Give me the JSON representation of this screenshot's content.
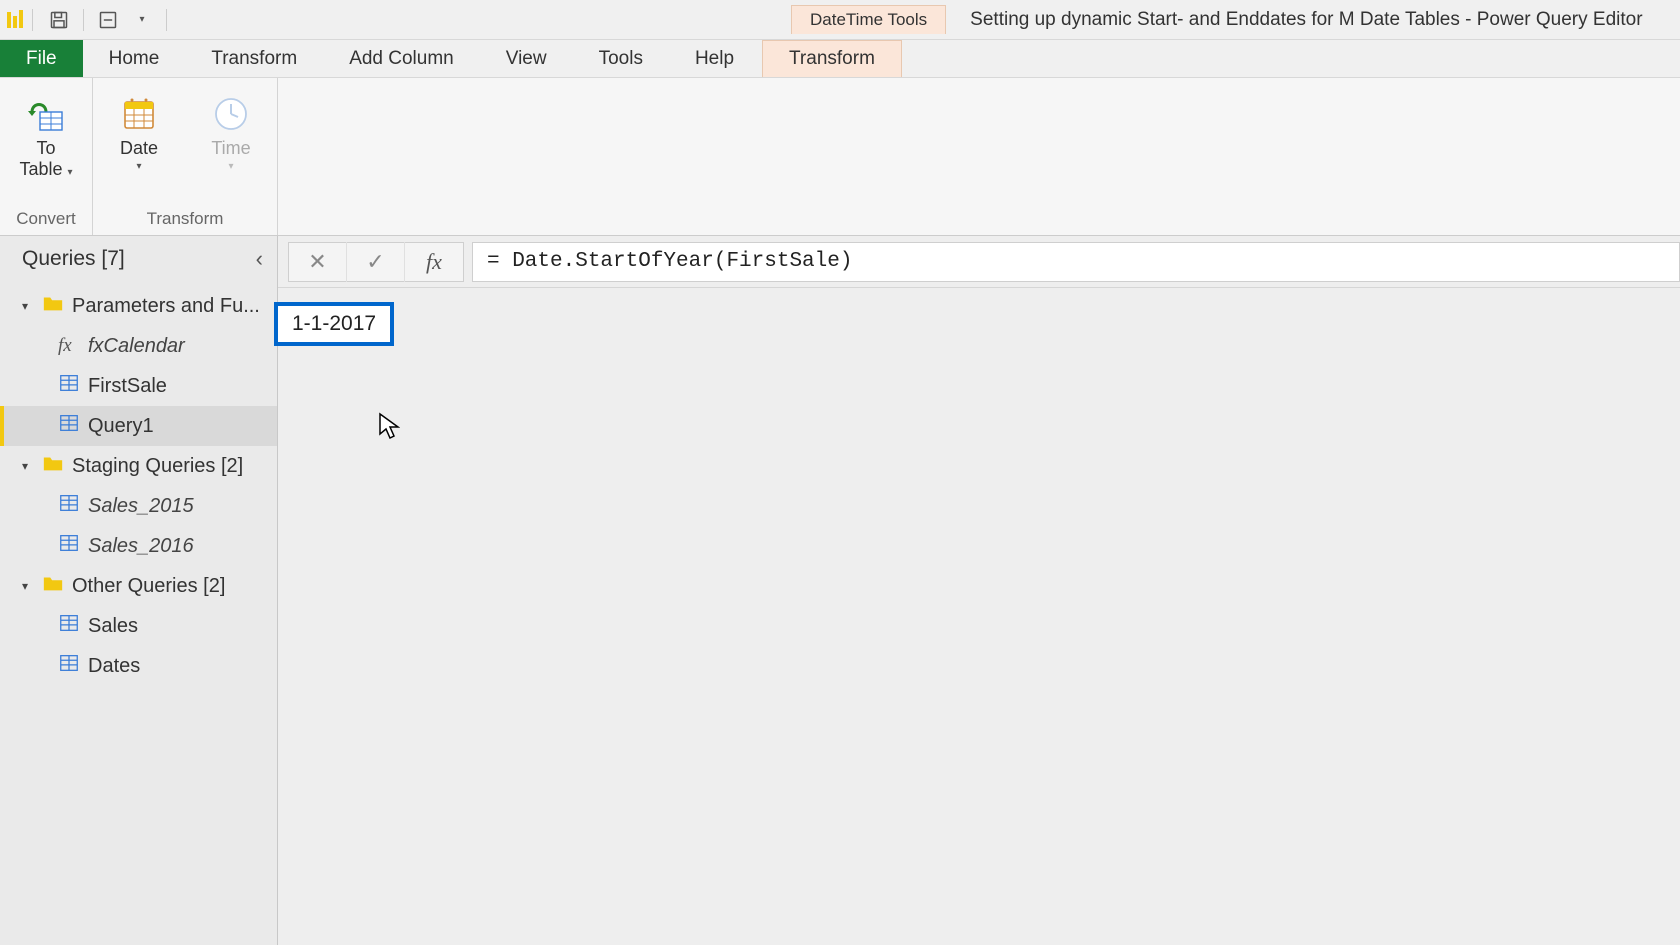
{
  "titlebar": {
    "contextual_tab": "DateTime Tools",
    "window_title": "Setting up dynamic Start- and Enddates for M Date Tables - Power Query Editor"
  },
  "ribbon_tabs": {
    "file": "File",
    "home": "Home",
    "transform": "Transform",
    "add_column": "Add Column",
    "view": "View",
    "tools": "Tools",
    "help": "Help",
    "contextual_transform": "Transform"
  },
  "ribbon": {
    "convert": {
      "to_table_line1": "To",
      "to_table_line2": "Table",
      "group_label": "Convert"
    },
    "transform": {
      "date": "Date",
      "time": "Time",
      "group_label": "Transform"
    }
  },
  "queries": {
    "header": "Queries [7]",
    "groups": [
      {
        "name": "Parameters and Fu...",
        "items": [
          {
            "label": "fxCalendar",
            "type": "fx",
            "italic": true
          },
          {
            "label": "FirstSale",
            "type": "table"
          },
          {
            "label": "Query1",
            "type": "table",
            "selected": true
          }
        ]
      },
      {
        "name": "Staging Queries [2]",
        "items": [
          {
            "label": "Sales_2015",
            "type": "table",
            "italic": true
          },
          {
            "label": "Sales_2016",
            "type": "table",
            "italic": true
          }
        ]
      },
      {
        "name": "Other Queries [2]",
        "items": [
          {
            "label": "Sales",
            "type": "table"
          },
          {
            "label": "Dates",
            "type": "table"
          }
        ]
      }
    ]
  },
  "formula_bar": {
    "expression": "= Date.StartOfYear(FirstSale)"
  },
  "result": {
    "value": "1-1-2017"
  }
}
